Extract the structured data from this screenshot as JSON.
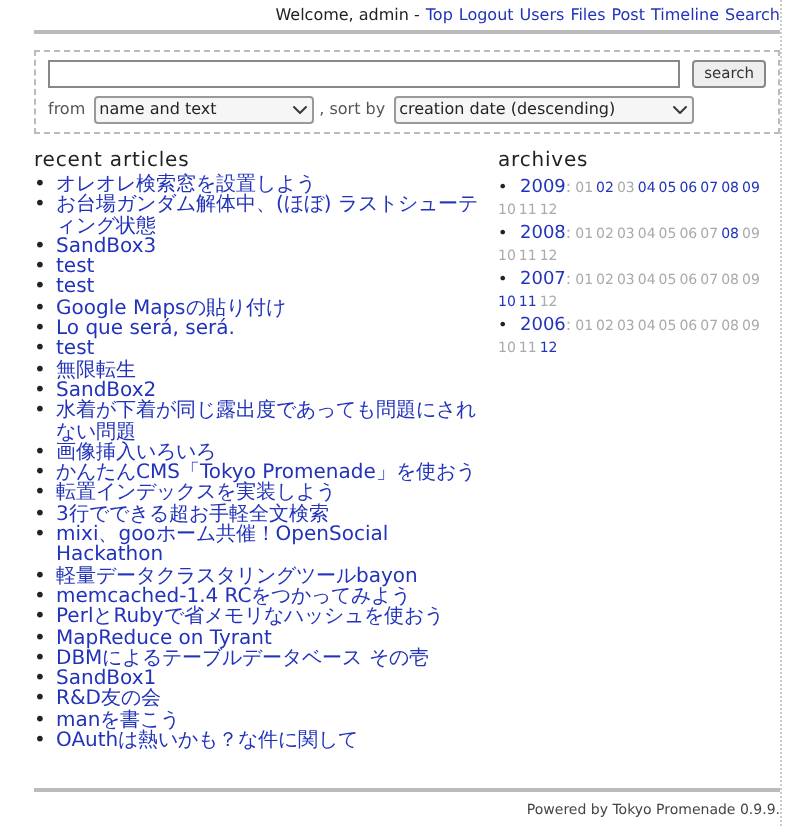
{
  "header": {
    "greeting": "Welcome, admin -",
    "links": [
      "Top",
      "Logout",
      "Users",
      "Files",
      "Post",
      "Timeline",
      "Search"
    ]
  },
  "search": {
    "button": "search",
    "from_label": "from",
    "from_value": "name and text",
    "sort_label": ", sort by",
    "sort_value": "creation date (descending)"
  },
  "recent_articles": {
    "title": "recent articles",
    "items": [
      {
        "bullet": "•",
        "title": "オレオレ検索窓を設置しよう"
      },
      {
        "bullet": "•",
        "title": "お台場ガンダム解体中、(ほぼ) ラストシューティング状態"
      },
      {
        "bullet": "•",
        "title": "SandBox3"
      },
      {
        "bullet": "•",
        "title": "test"
      },
      {
        "bullet": "•",
        "title": "test"
      },
      {
        "bullet": "•",
        "title": "Google Mapsの貼り付け"
      },
      {
        "bullet": "•",
        "title": "Lo que será, será."
      },
      {
        "bullet": "•",
        "title": "test"
      },
      {
        "bullet": "•",
        "title": "無限転生"
      },
      {
        "bullet": "•",
        "title": "SandBox2"
      },
      {
        "bullet": "•",
        "title": "水着が下着が同じ露出度であっても問題にされない問題"
      },
      {
        "bullet": "•",
        "title": "画像挿入いろいろ"
      },
      {
        "bullet": "•",
        "title": "かんたんCMS「Tokyo Promenade」を使おう"
      },
      {
        "bullet": "•",
        "title": "転置インデックスを実装しよう"
      },
      {
        "bullet": "•",
        "title": "3行でできる超お手軽全文検索"
      },
      {
        "bullet": "•",
        "title": "mixi、gooホーム共催！OpenSocial Hackathon"
      },
      {
        "bullet": "•",
        "title": "軽量データクラスタリングツールbayon"
      },
      {
        "bullet": "•",
        "title": "memcached-1.4 RCをつかってみよう"
      },
      {
        "bullet": "•",
        "title": "PerlとRubyで省メモリなハッシュを使おう"
      },
      {
        "bullet": "•",
        "title": "MapReduce on Tyrant"
      },
      {
        "bullet": "•",
        "title": "DBMによるテーブルデータベース その壱"
      },
      {
        "bullet": "•",
        "title": "SandBox1"
      },
      {
        "bullet": "•",
        "title": "R&D友の会"
      },
      {
        "bullet": "•",
        "title": "manを書こう"
      },
      {
        "bullet": "•",
        "title": "OAuthは熱いかも？な件に関して"
      }
    ]
  },
  "archives": {
    "title": "archives",
    "years": [
      {
        "bullet": "•",
        "year": "2009",
        "separator": ":",
        "months": [
          {
            "label": "01",
            "linked": false
          },
          {
            "label": "02",
            "linked": true
          },
          {
            "label": "03",
            "linked": false
          },
          {
            "label": "04",
            "linked": true
          },
          {
            "label": "05",
            "linked": true
          },
          {
            "label": "06",
            "linked": true
          },
          {
            "label": "07",
            "linked": true
          },
          {
            "label": "08",
            "linked": true
          },
          {
            "label": "09",
            "linked": true
          },
          {
            "label": "10",
            "linked": false
          },
          {
            "label": "11",
            "linked": false
          },
          {
            "label": "12",
            "linked": false
          }
        ]
      },
      {
        "bullet": "•",
        "year": "2008",
        "separator": ":",
        "months": [
          {
            "label": "01",
            "linked": false
          },
          {
            "label": "02",
            "linked": false
          },
          {
            "label": "03",
            "linked": false
          },
          {
            "label": "04",
            "linked": false
          },
          {
            "label": "05",
            "linked": false
          },
          {
            "label": "06",
            "linked": false
          },
          {
            "label": "07",
            "linked": false
          },
          {
            "label": "08",
            "linked": true
          },
          {
            "label": "09",
            "linked": false
          },
          {
            "label": "10",
            "linked": false
          },
          {
            "label": "11",
            "linked": false
          },
          {
            "label": "12",
            "linked": false
          }
        ]
      },
      {
        "bullet": "•",
        "year": "2007",
        "separator": ":",
        "months": [
          {
            "label": "01",
            "linked": false
          },
          {
            "label": "02",
            "linked": false
          },
          {
            "label": "03",
            "linked": false
          },
          {
            "label": "04",
            "linked": false
          },
          {
            "label": "05",
            "linked": false
          },
          {
            "label": "06",
            "linked": false
          },
          {
            "label": "07",
            "linked": false
          },
          {
            "label": "08",
            "linked": false
          },
          {
            "label": "09",
            "linked": false
          },
          {
            "label": "10",
            "linked": true
          },
          {
            "label": "11",
            "linked": true
          },
          {
            "label": "12",
            "linked": false
          }
        ]
      },
      {
        "bullet": "•",
        "year": "2006",
        "separator": ":",
        "months": [
          {
            "label": "01",
            "linked": false
          },
          {
            "label": "02",
            "linked": false
          },
          {
            "label": "03",
            "linked": false
          },
          {
            "label": "04",
            "linked": false
          },
          {
            "label": "05",
            "linked": false
          },
          {
            "label": "06",
            "linked": false
          },
          {
            "label": "07",
            "linked": false
          },
          {
            "label": "08",
            "linked": false
          },
          {
            "label": "09",
            "linked": false
          },
          {
            "label": "10",
            "linked": false
          },
          {
            "label": "11",
            "linked": false
          },
          {
            "label": "12",
            "linked": true
          }
        ]
      }
    ]
  },
  "footer": "Powered by Tokyo Promenade 0.9.9."
}
